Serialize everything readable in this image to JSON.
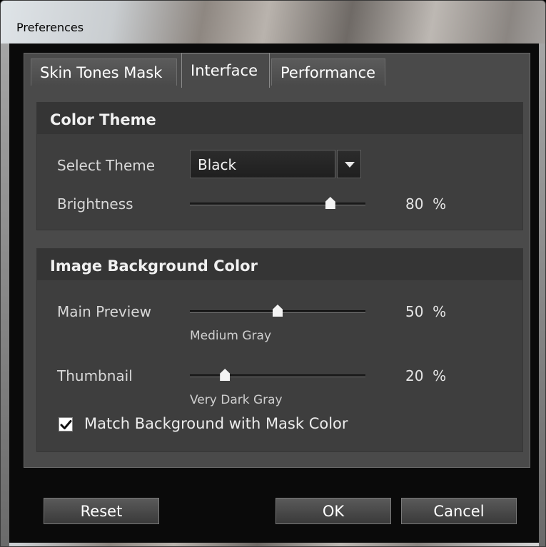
{
  "window": {
    "title": "Preferences"
  },
  "tabs": [
    {
      "label": "Skin Tones Mask",
      "active": false
    },
    {
      "label": "Interface",
      "active": true
    },
    {
      "label": "Performance",
      "active": false
    }
  ],
  "color_theme": {
    "title": "Color Theme",
    "select_theme_label": "Select Theme",
    "select_theme_value": "Black",
    "brightness_label": "Brightness",
    "brightness_value": 80,
    "brightness_text": "80  %"
  },
  "image_background": {
    "title": "Image Background Color",
    "main_preview_label": "Main Preview",
    "main_preview_value": 50,
    "main_preview_text": "50  %",
    "main_preview_caption": "Medium Gray",
    "thumbnail_label": "Thumbnail",
    "thumbnail_value": 20,
    "thumbnail_text": "20  %",
    "thumbnail_caption": "Very Dark Gray",
    "match_checkbox_label": "Match Background with Mask Color",
    "match_checkbox_checked": true
  },
  "buttons": {
    "reset": "Reset",
    "ok": "OK",
    "cancel": "Cancel"
  },
  "colors": {
    "panel": "#4a4a4a",
    "group": "#3e3e3e",
    "text": "#d8d8d8",
    "background": "#0a0a0a"
  }
}
